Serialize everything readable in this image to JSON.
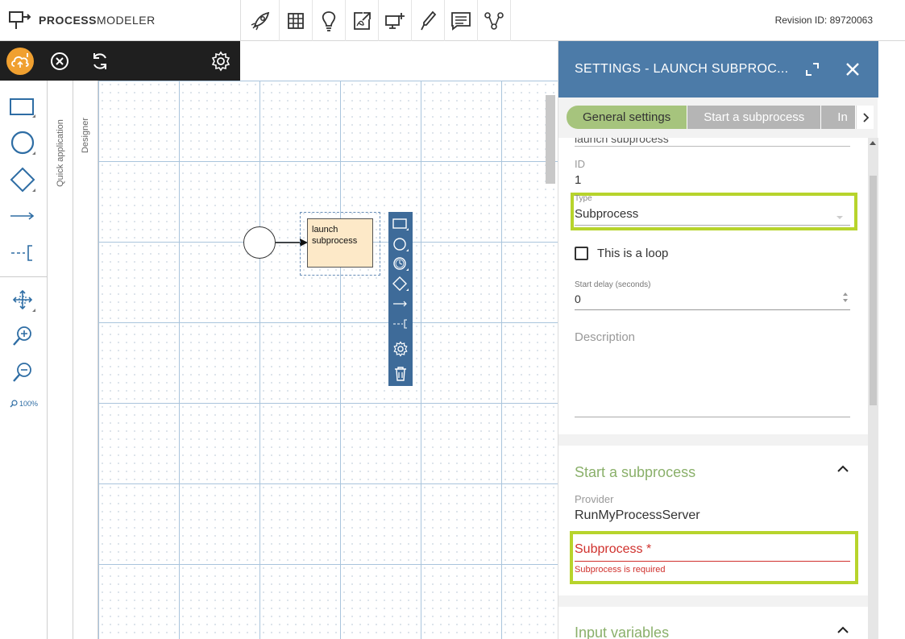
{
  "app": {
    "logo_bold": "PROCESS",
    "logo_thin": "MODELER",
    "revision": "Revision ID: 89720063"
  },
  "top_tools": [
    "rocket-icon",
    "table-icon",
    "lightbulb-icon",
    "export-pdf-icon",
    "screen-add-icon",
    "pipette-icon",
    "list-icon",
    "connections-icon"
  ],
  "dark_toolbar": [
    "cloud-status-icon",
    "cancel-icon",
    "refresh-icon",
    "gear-icon"
  ],
  "palette": {
    "items": [
      "rectangle-task-icon",
      "circle-event-icon",
      "diamond-gateway-icon",
      "arrow-flow-icon",
      "annotation-icon",
      "move-tool-icon",
      "zoom-in-icon",
      "zoom-out-icon"
    ],
    "zoom": "100%"
  },
  "vertical_tabs": {
    "quick_application": "Quick application",
    "designer": "Designer"
  },
  "diagram": {
    "task_label": "launch subprocess"
  },
  "panel": {
    "title": "SETTINGS - LAUNCH SUBPROC...",
    "tabs": [
      "General settings",
      "Start a subprocess",
      "In"
    ],
    "name_value_clipped": "launch subprocess",
    "id_label": "ID",
    "id_value": "1",
    "type_label": "Type",
    "type_value": "Subprocess",
    "loop_label": "This is a loop",
    "loop_checked": false,
    "start_delay_label": "Start delay (seconds)",
    "start_delay_value": "0",
    "description_label": "Description",
    "section_start": "Start a subprocess",
    "provider_label": "Provider",
    "provider_value": "RunMyProcessServer",
    "subprocess_label": "Subprocess *",
    "subprocess_error": "Subprocess is required",
    "section_input": "Input variables"
  },
  "colors": {
    "panel_header": "#4c7ba8",
    "active_tab": "#a6c47d",
    "highlight": "#b7d42c",
    "error": "#d0312d",
    "section_title": "#8ab06a"
  }
}
